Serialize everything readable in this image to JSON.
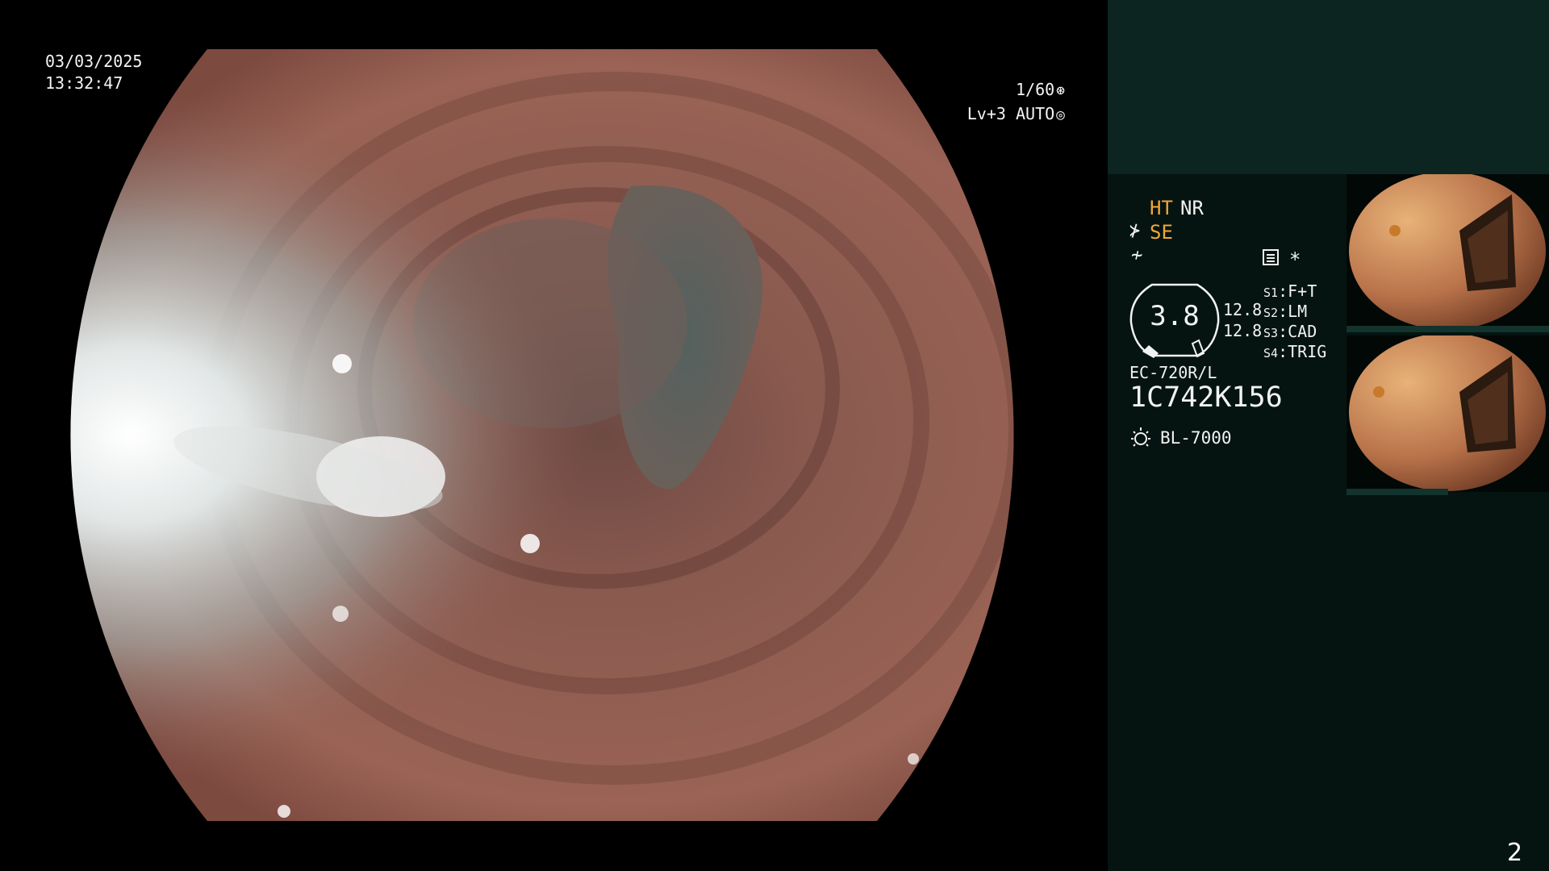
{
  "overlay": {
    "date": "03/03/2025",
    "time": "13:32:47",
    "shutter": "1/60",
    "level": "Lv+3",
    "iris": "AUTO"
  },
  "panel": {
    "ht": "HT",
    "nr": "NR",
    "se": "SE",
    "star": "*",
    "gauge_value": "3.8",
    "value_1": "12.8",
    "value_2": "12.8",
    "slots": [
      {
        "key": "S1",
        "label": "F+T"
      },
      {
        "key": "S2",
        "label": "LM"
      },
      {
        "key": "S3",
        "label": "CAD"
      },
      {
        "key": "S4",
        "label": "TRIG"
      }
    ],
    "scope_model": "EC-720R/L",
    "serial": "1C742K156",
    "light_source": "BL-7000"
  },
  "page_number": "2",
  "colors": {
    "panel_bg": "#051410",
    "panel_top_bg": "#0c2520",
    "accent_orange": "#f0a53a",
    "tissue": "#8e5a4c"
  },
  "icons": {
    "shutter": "aperture-icon",
    "iris": "iris-icon",
    "se": "structure-enhancement-icon",
    "filter": "filter-icon",
    "memory": "memory-card-icon",
    "light": "light-source-icon"
  }
}
